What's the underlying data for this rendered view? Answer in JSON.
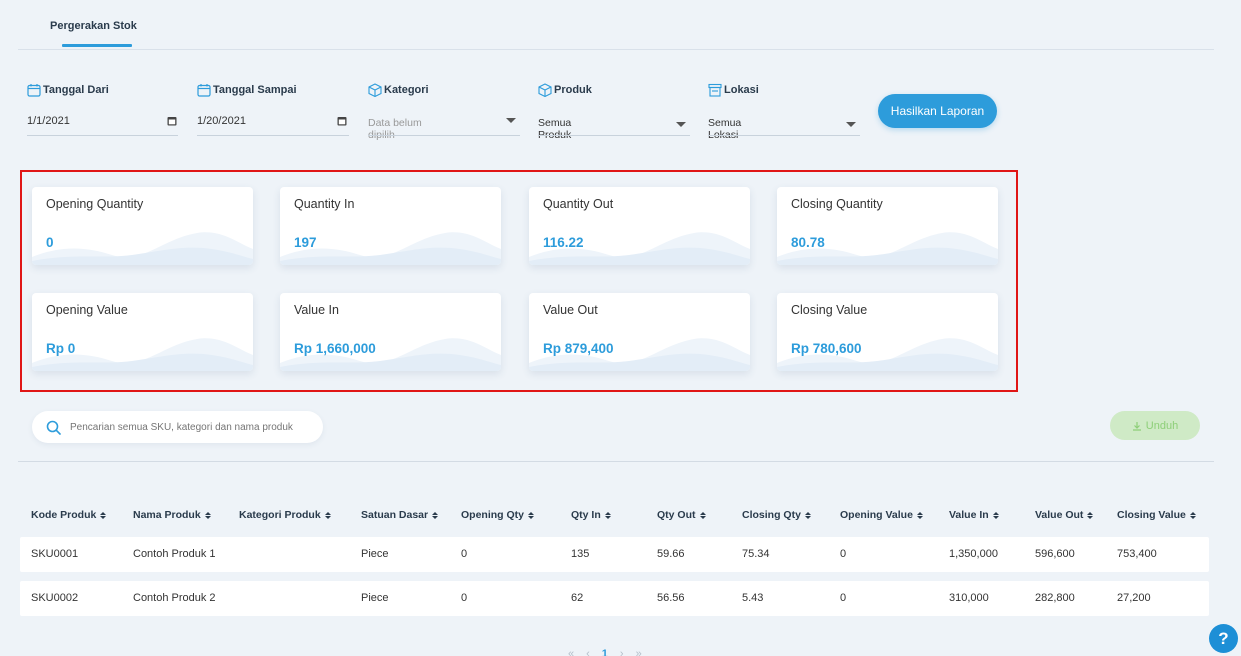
{
  "tabs": [
    {
      "label": "Pergerakan Stok"
    }
  ],
  "filters": {
    "date_from": {
      "label": "Tanggal Dari",
      "value": "1/1/2021"
    },
    "date_to": {
      "label": "Tanggal Sampai",
      "value": "1/20/2021"
    },
    "category": {
      "label": "Kategori",
      "placeholder": "Data belum dipilih"
    },
    "product": {
      "label": "Produk",
      "value": "Semua Produk"
    },
    "location": {
      "label": "Lokasi",
      "value": "Semua Lokasi"
    },
    "generate_label": "Hasilkan Laporan"
  },
  "summary": [
    {
      "label": "Opening Quantity",
      "value": "0"
    },
    {
      "label": "Quantity In",
      "value": "197"
    },
    {
      "label": "Quantity Out",
      "value": "116.22"
    },
    {
      "label": "Closing Quantity",
      "value": "80.78"
    },
    {
      "label": "Opening Value",
      "value": "Rp 0"
    },
    {
      "label": "Value In",
      "value": "Rp 1,660,000"
    },
    {
      "label": "Value Out",
      "value": "Rp 879,400"
    },
    {
      "label": "Closing Value",
      "value": "Rp 780,600"
    }
  ],
  "search": {
    "placeholder": "Pencarian semua SKU, kategori dan nama produk"
  },
  "download_label": "Unduh",
  "table": {
    "columns": [
      "Kode Produk",
      "Nama Produk",
      "Kategori Produk",
      "Satuan Dasar",
      "Opening Qty",
      "Qty In",
      "Qty Out",
      "Closing Qty",
      "Opening Value",
      "Value In",
      "Value Out",
      "Closing Value"
    ],
    "rows": [
      [
        "SKU0001",
        "Contoh Produk 1",
        "",
        "Piece",
        "0",
        "135",
        "59.66",
        "75.34",
        "0",
        "1,350,000",
        "596,600",
        "753,400"
      ],
      [
        "SKU0002",
        "Contoh Produk 2",
        "",
        "Piece",
        "0",
        "62",
        "56.56",
        "5.43",
        "0",
        "310,000",
        "282,800",
        "27,200"
      ]
    ]
  },
  "pagination": {
    "current": "1"
  },
  "help_label": "?",
  "colors": {
    "accent": "#2d9cdb",
    "highlight_border": "#e01616",
    "download_bg": "#cfeac6"
  }
}
